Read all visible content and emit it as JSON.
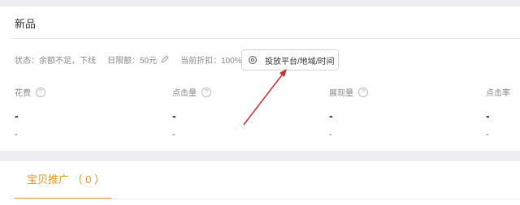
{
  "card": {
    "title": "新品",
    "status_label": "状态：余额不足，下线",
    "daily_limit_label": "日限额：50元",
    "discount_label": "当前折扣：100%",
    "platform_button_label": "投放平台/地域/时间"
  },
  "metrics": [
    {
      "label": "花费",
      "value": "-",
      "sub": "-"
    },
    {
      "label": "点击量",
      "value": "-",
      "sub": "-"
    },
    {
      "label": "展现量",
      "value": "-",
      "sub": "-"
    },
    {
      "label": "点击率",
      "value": "-",
      "sub": "-"
    }
  ],
  "tabs": {
    "promo_label": "宝贝推广 （ 0 ）"
  },
  "colors": {
    "accent": "#e8931c",
    "arrow": "#d42a2a"
  },
  "icons": {
    "edit": "pencil-icon",
    "platform": "target-icon",
    "help": "question-circle-icon"
  }
}
